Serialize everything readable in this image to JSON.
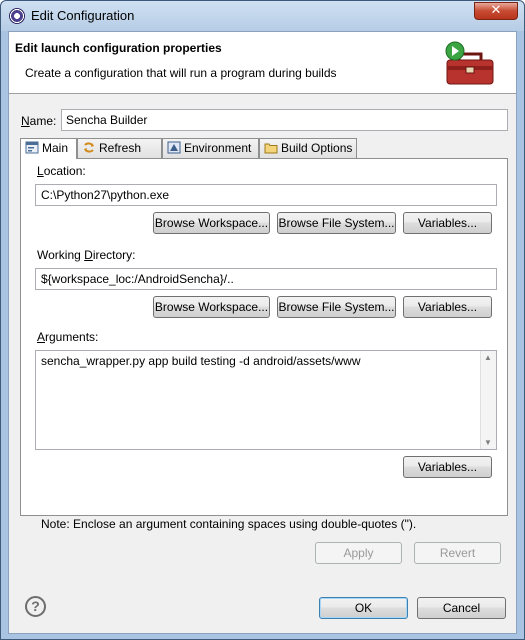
{
  "window": {
    "title": "Edit Configuration",
    "close_glyph": "✕"
  },
  "banner": {
    "title": "Edit launch configuration properties",
    "description": "Create a configuration that will run a program during builds"
  },
  "name": {
    "label_prefix": "N",
    "label_rest": "ame:",
    "value": "Sencha Builder"
  },
  "tabs": [
    {
      "label": "Main",
      "icon": "main-tab-icon"
    },
    {
      "label": "Refresh",
      "icon": "refresh-icon"
    },
    {
      "label": "Environment",
      "icon": "environment-icon"
    },
    {
      "label": "Build Options",
      "icon": "folder-icon"
    }
  ],
  "location": {
    "label_prefix": "L",
    "label_rest": "ocation:",
    "value": "C:\\Python27\\python.exe",
    "buttons": [
      "Browse Workspace...",
      "Browse File System...",
      "Variables..."
    ]
  },
  "working_directory": {
    "label_start": "Working ",
    "label_underline": "D",
    "label_rest": "irectory:",
    "value": "${workspace_loc:/AndroidSencha}/..",
    "buttons": [
      "Browse Workspace...",
      "Browse File System...",
      "Variables..."
    ]
  },
  "arguments": {
    "label_prefix": "A",
    "label_rest": "rguments:",
    "value": "sencha_wrapper.py app build testing -d android/assets/www",
    "variables_button": "Variables...",
    "note": "Note: Enclose an argument containing spaces using double-quotes (\")."
  },
  "footer": {
    "apply": "Apply",
    "revert": "Revert",
    "ok": "OK",
    "cancel": "Cancel",
    "help": "?"
  }
}
